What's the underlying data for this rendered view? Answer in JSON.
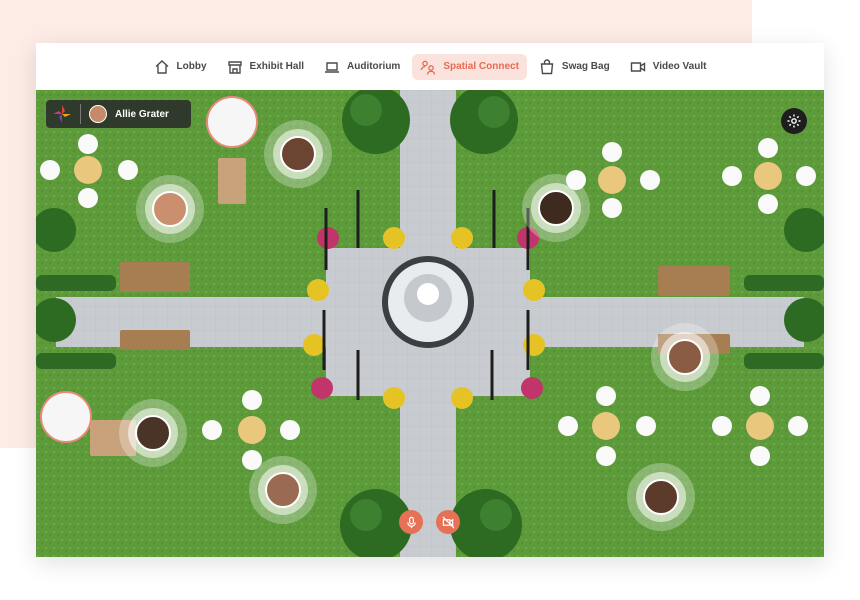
{
  "nav": {
    "items": [
      {
        "label": "Lobby",
        "icon": "home-icon"
      },
      {
        "label": "Exhibit Hall",
        "icon": "booth-icon"
      },
      {
        "label": "Auditorium",
        "icon": "laptop-icon"
      },
      {
        "label": "Spatial Connect",
        "icon": "people-icon"
      },
      {
        "label": "Swag Bag",
        "icon": "bag-icon"
      },
      {
        "label": "Video Vault",
        "icon": "video-icon"
      }
    ],
    "active": "Spatial Connect"
  },
  "user": {
    "name": "Allie Grater"
  },
  "colors": {
    "accent": "#e76b53",
    "accent_bg": "#fbe3dd",
    "grass": "#5c9a3a",
    "path": "#c9ccd0",
    "mic": "#e57256"
  },
  "attendees": [
    {
      "name": "attendee-1",
      "skin": "#6b4432"
    },
    {
      "name": "attendee-2",
      "skin": "#c98f6e"
    },
    {
      "name": "attendee-3",
      "skin": "#3f2a20"
    },
    {
      "name": "attendee-4",
      "skin": "#8a5c44"
    },
    {
      "name": "attendee-5",
      "skin": "#4a3428"
    },
    {
      "name": "attendee-6",
      "skin": "#9b6a52"
    },
    {
      "name": "attendee-7",
      "skin": "#5d3b2a"
    }
  ],
  "controls": {
    "mic": "microphone-icon",
    "camera": "camera-off-icon"
  }
}
